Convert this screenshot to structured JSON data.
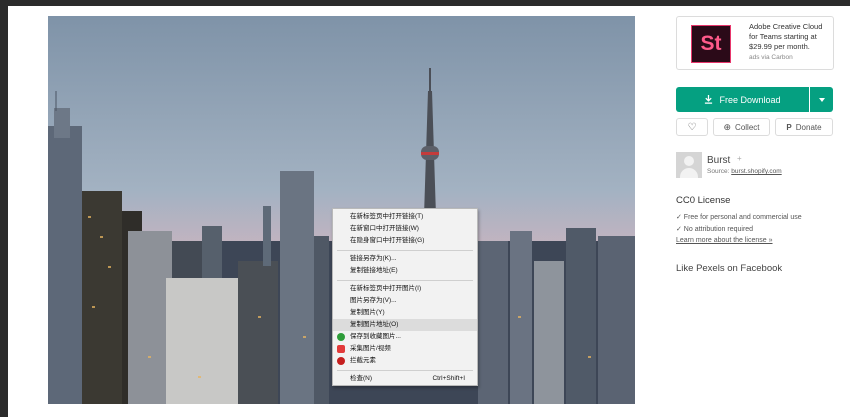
{
  "ad": {
    "logo_text": "St",
    "text": "Adobe Creative Cloud for Teams starting at $29.99 per month.",
    "via": "ads via Carbon"
  },
  "download": {
    "label": "Free Download"
  },
  "actions": {
    "collect": "Collect",
    "donate": "Donate"
  },
  "author": {
    "name": "Burst",
    "follow": "+",
    "source_label": "Source:",
    "source_link": "burst.shopify.com"
  },
  "license": {
    "title": "CC0 License",
    "items": [
      "✓ Free for personal and commercial use",
      "✓ No attribution required"
    ],
    "link": "Learn more about the license »"
  },
  "facebook": {
    "title": "Like Pexels on Facebook"
  },
  "context_menu": {
    "items": [
      {
        "label": "在新标签页中打开链接(T)"
      },
      {
        "label": "在新窗口中打开链接(W)"
      },
      {
        "label": "在隐身窗口中打开链接(G)"
      },
      {
        "label": "链接另存为(K)..."
      },
      {
        "label": "复制链接地址(E)"
      },
      {
        "label": "在新标签页中打开图片(I)"
      },
      {
        "label": "图片另存为(V)..."
      },
      {
        "label": "复制图片(Y)"
      },
      {
        "label": "复制图片地址(O)"
      },
      {
        "label": "保存到收藏图片..."
      },
      {
        "label": "采集图片/视频"
      },
      {
        "label": "拦截元素"
      },
      {
        "label": "检查(N)",
        "shortcut": "Ctrl+Shift+I"
      }
    ],
    "icon_colors": {
      "save": "#2e9d3a",
      "collect": "#e23a3a",
      "block": "#c51f1f"
    }
  }
}
